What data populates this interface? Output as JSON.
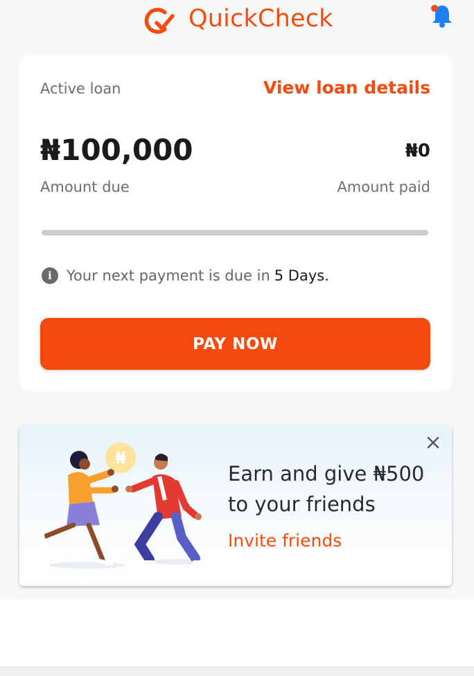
{
  "header": {
    "brand": "QuickCheck"
  },
  "loan": {
    "active_label": "Active loan",
    "view_details": "View loan details",
    "amount_due_value": "₦100,000",
    "amount_due_label": "Amount due",
    "amount_paid_value": "₦0",
    "amount_paid_label": "Amount paid",
    "progress_fraction": 0,
    "info_text": "Your next payment is due in",
    "info_days": "5 Days.",
    "pay_button": "PAY NOW"
  },
  "referral": {
    "coin_symbol": "₦",
    "title_line1": "Earn and give ₦500",
    "title_line2": "to your friends",
    "invite_label": "Invite friends"
  },
  "icons": {
    "logo": "quickcheck-logo-icon",
    "bell": "bell-icon",
    "info": "info-icon",
    "close": "close-icon"
  },
  "colors": {
    "brand": "#f24d0f",
    "button": "#f44a0d",
    "bell": "#1e7ff0",
    "notification_dot": "#f04a1a"
  }
}
